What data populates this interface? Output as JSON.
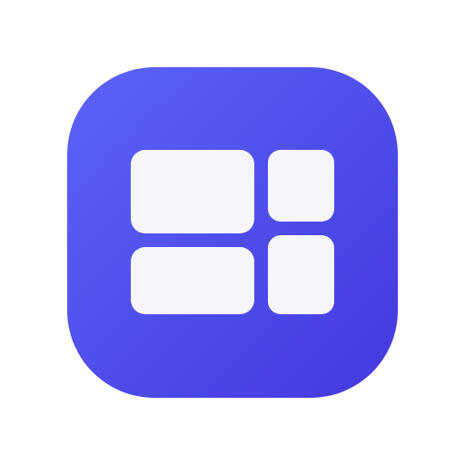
{
  "app_icon": {
    "icon": "dashboard-grid-icon",
    "colors": {
      "background_start": "#5C64F8",
      "background_end": "#4438DE",
      "tile_fill": "#F5F6FA"
    },
    "tiles": [
      "large-tile-top-left",
      "small-tile-top-right",
      "wide-tile-bottom-left",
      "small-tile-bottom-right"
    ]
  }
}
